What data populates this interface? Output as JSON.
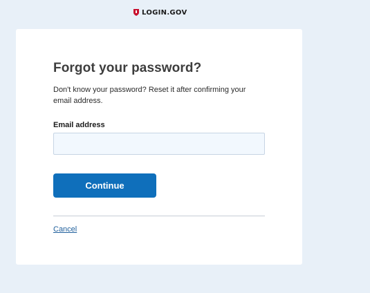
{
  "header": {
    "brand": "LOGIN.GOV",
    "logo_icon": "shield-icon",
    "brand_color": "#c8102e"
  },
  "form": {
    "title": "Forgot your password?",
    "intro": "Don't know your password? Reset it after confirming your email address.",
    "email_label": "Email address",
    "email_value": "",
    "continue_label": "Continue",
    "cancel_label": "Cancel"
  },
  "colors": {
    "page_background": "#e8f0f8",
    "primary_button": "#0f6fbb",
    "link": "#1f5f9c",
    "input_background": "#f2f8fe"
  }
}
